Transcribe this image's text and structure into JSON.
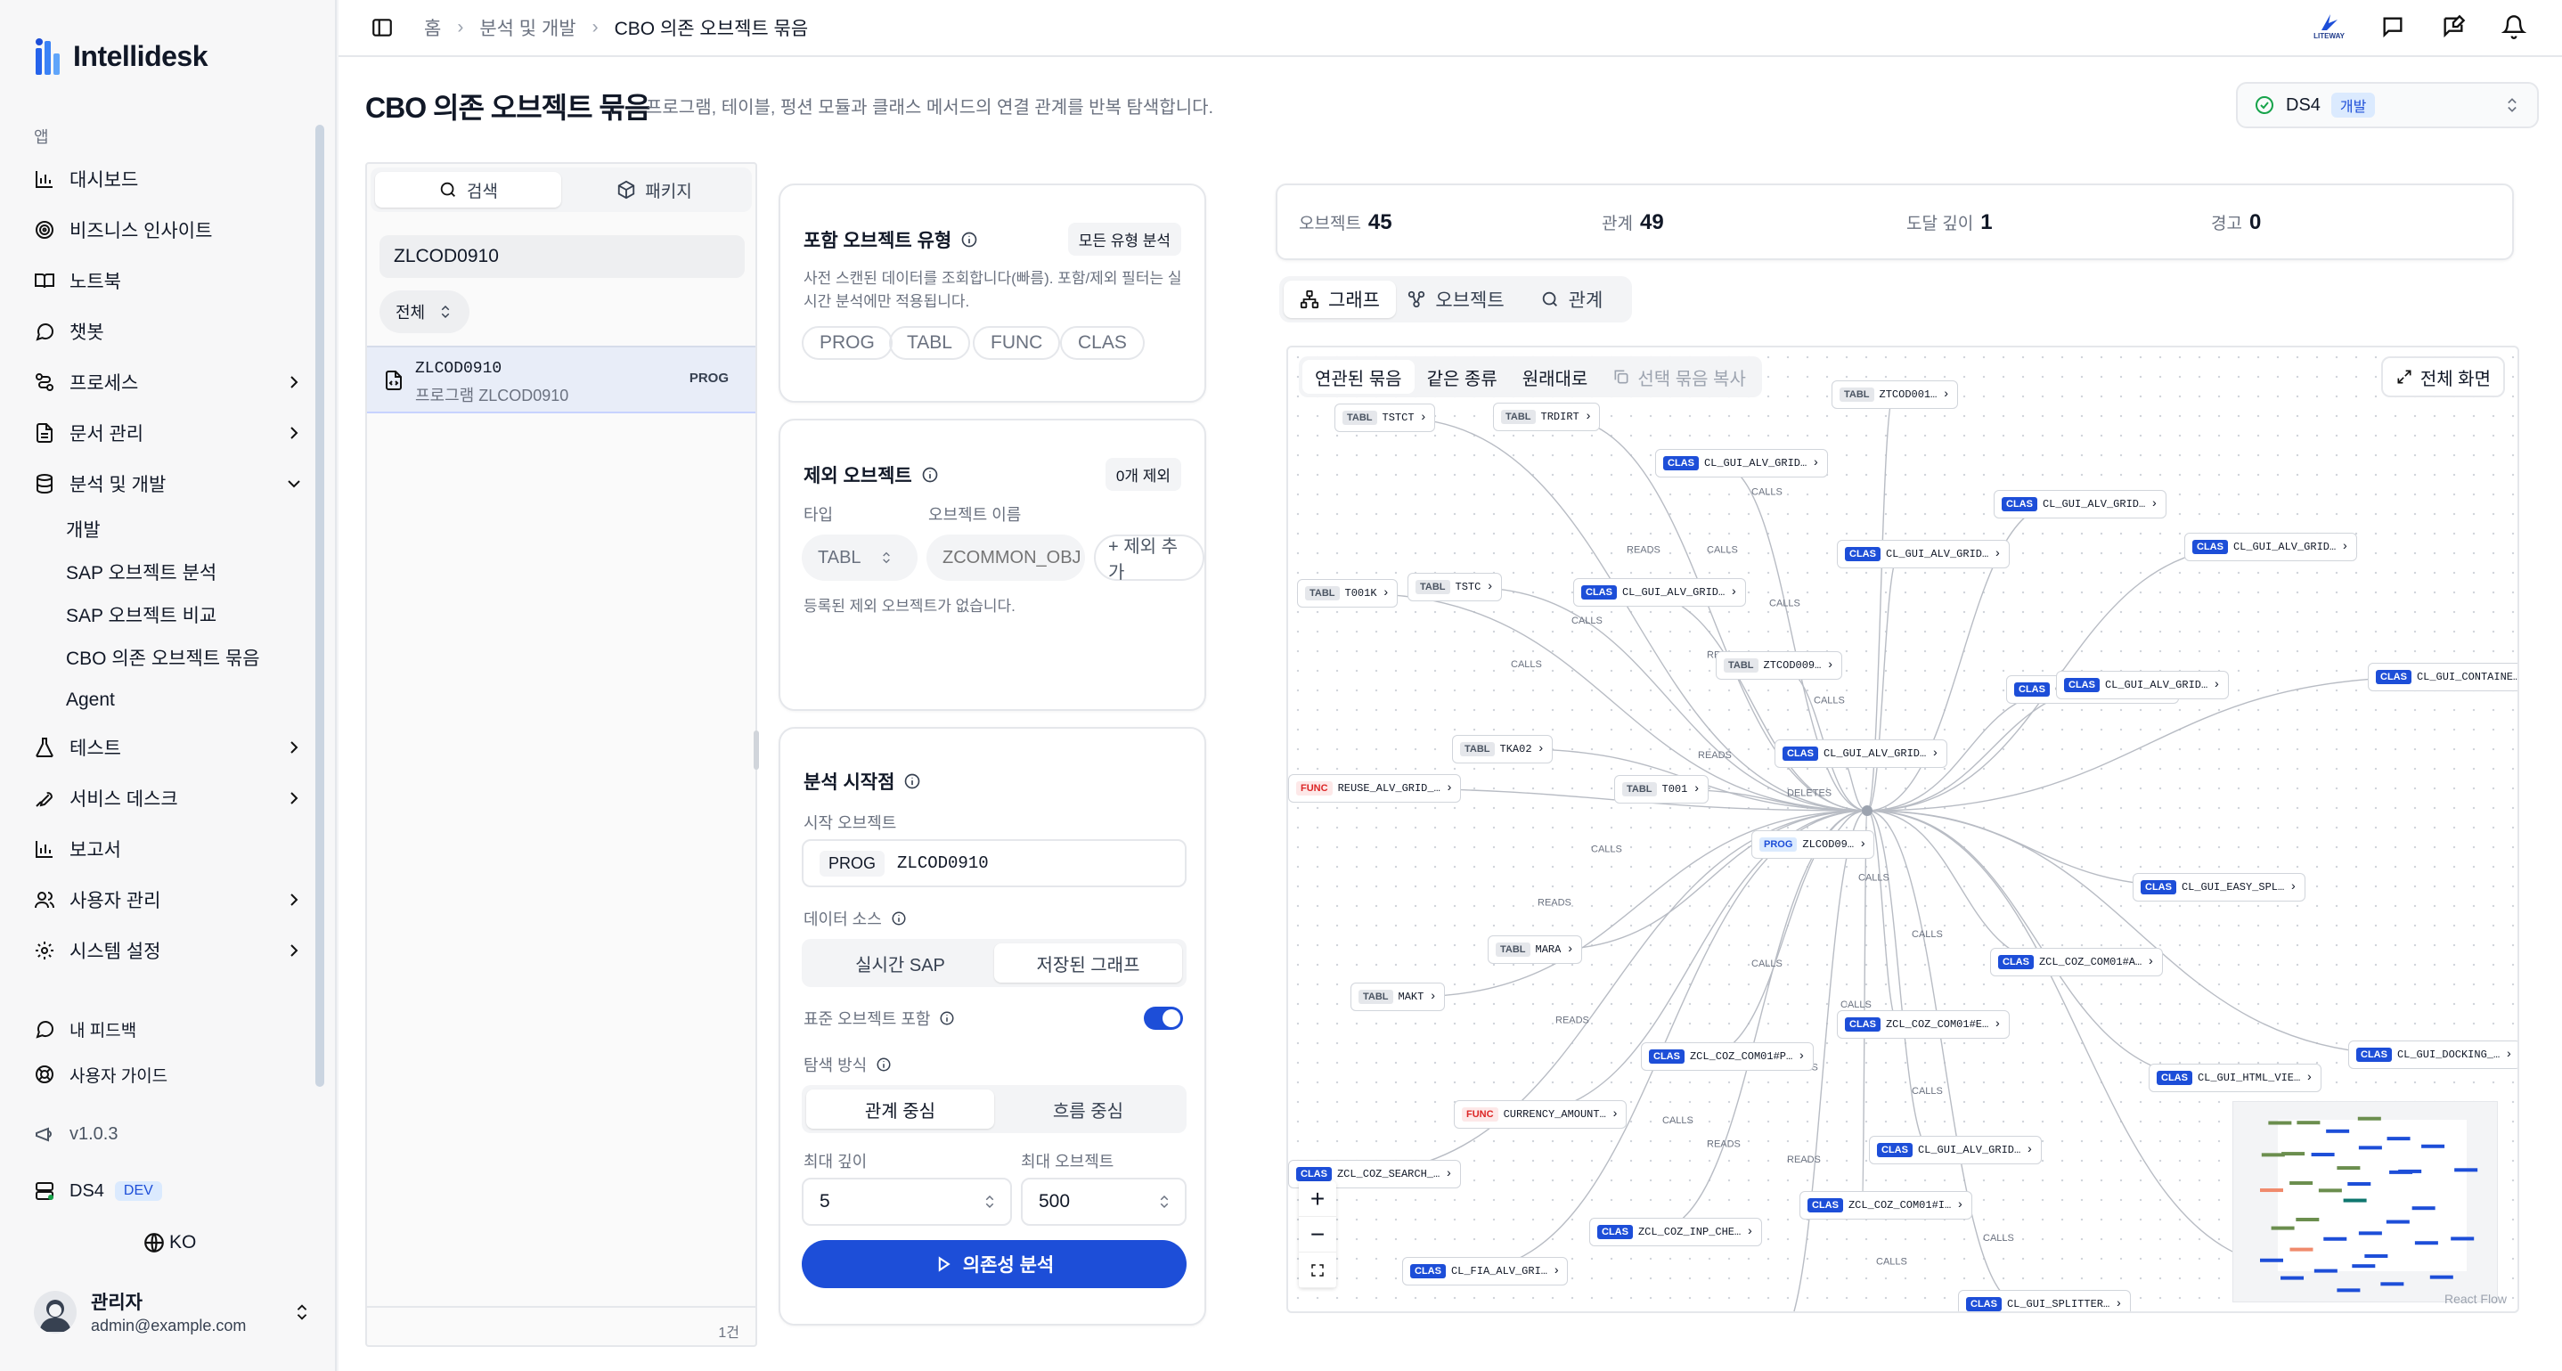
{
  "app": {
    "name": "Intellidesk"
  },
  "sidebar": {
    "section_label": "앱",
    "items": [
      {
        "label": "대시보드",
        "icon": "bar-chart-icon"
      },
      {
        "label": "비즈니스 인사이트",
        "icon": "target-icon"
      },
      {
        "label": "노트북",
        "icon": "book-icon"
      },
      {
        "label": "챗봇",
        "icon": "chat-icon"
      },
      {
        "label": "프로세스",
        "icon": "route-icon"
      },
      {
        "label": "문서 관리",
        "icon": "file-icon"
      },
      {
        "label": "분석 및 개발",
        "icon": "database-icon"
      },
      {
        "label": "테스트",
        "icon": "flask-icon"
      },
      {
        "label": "서비스 데스크",
        "icon": "wrench-icon"
      },
      {
        "label": "보고서",
        "icon": "bar-chart-icon"
      },
      {
        "label": "사용자 관리",
        "icon": "users-icon"
      },
      {
        "label": "시스템 설정",
        "icon": "gear-icon"
      }
    ],
    "sub_items": [
      "개발",
      "SAP 오브젝트 분석",
      "SAP 오브젝트 비교",
      "CBO 의존 오브젝트 묶음",
      "Agent"
    ],
    "feedback": "내 피드백",
    "guide": "사용자 가이드",
    "version": "v1.0.3",
    "system": "DS4",
    "system_badge": "DEV",
    "language": "KO",
    "user": {
      "name": "관리자",
      "email": "admin@example.com"
    }
  },
  "breadcrumb": [
    "홈",
    "분석 및 개발",
    "CBO 의존 오브젝트 묶음"
  ],
  "topbar": {
    "brand": "LITEWAY"
  },
  "page": {
    "title": "CBO 의존 오브젝트 묶음",
    "description": "프로그램, 테이블, 펑션 모듈과 클래스 메서드의 연결 관계를 반복 탐색합니다."
  },
  "env": {
    "name": "DS4",
    "badge": "개발"
  },
  "left_panel": {
    "tabs": [
      "검색",
      "패키지"
    ],
    "search_value": "ZLCOD0910",
    "filter": "전체",
    "results": [
      {
        "name": "ZLCOD0910",
        "desc": "프로그램 ZLCOD0910",
        "type": "PROG"
      }
    ],
    "count": "1건"
  },
  "include_card": {
    "title": "포함 오브젝트 유형",
    "pill": "모든 유형 분석",
    "desc": "사전 스캔된 데이터를 조회합니다(빠름). 포함/제외 필터는 실시간 분석에만 적용됩니다.",
    "types": [
      "PROG",
      "TABL",
      "FUNC",
      "CLAS"
    ]
  },
  "exclude_card": {
    "title": "제외 오브젝트",
    "pill": "0개 제외",
    "type_label": "타입",
    "name_label": "오브젝트 이름",
    "type_value": "TABL",
    "name_placeholder": "ZCOMMON_OBJ",
    "add_button": "+ 제외 추가",
    "empty": "등록된 제외 오브젝트가 없습니다."
  },
  "start_card": {
    "title": "분석 시작점",
    "start_label": "시작 오브젝트",
    "start_type": "PROG",
    "start_value": "ZLCOD0910",
    "source_label": "데이터 소스",
    "source_options": [
      "실시간 SAP",
      "저장된 그래프"
    ],
    "standard_label": "표준 오브젝트 포함",
    "mode_label": "탐색 방식",
    "mode_options": [
      "관계 중심",
      "흐름 중심"
    ],
    "depth_label": "최대 깊이",
    "depth_value": "5",
    "max_label": "최대 오브젝트",
    "max_value": "500",
    "run_button": "의존성 분석"
  },
  "stats": [
    {
      "label": "오브젝트",
      "value": "45"
    },
    {
      "label": "관계",
      "value": "49"
    },
    {
      "label": "도달 깊이",
      "value": "1"
    },
    {
      "label": "경고",
      "value": "0"
    }
  ],
  "view_tabs": [
    "그래프",
    "오브젝트",
    "관계"
  ],
  "graph_toolbar": [
    "연관된 묶음",
    "같은 종류",
    "원래대로",
    "선택 묶음 복사"
  ],
  "fullscreen": "전체 화면",
  "react_flow": "React Flow",
  "edge_labels": [
    "CALLS",
    "READS",
    "DELETES"
  ],
  "nodes": [
    {
      "type": "TABL",
      "name": "TSTCT"
    },
    {
      "type": "TABL",
      "name": "TRDIRT"
    },
    {
      "type": "CLAS",
      "name": "CL_GUI_ALV_GRID…"
    },
    {
      "type": "TABL",
      "name": "ZTCOD001…"
    },
    {
      "type": "CLAS",
      "name": "CL_GUI_ALV_GRID…"
    },
    {
      "type": "CLAS",
      "name": "CL_GUI_ALV_GRID…"
    },
    {
      "type": "CLAS",
      "name": "CL_GUI_ALV_GRID…"
    },
    {
      "type": "CLAS",
      "name": "CL_GUI_ALV_GRID…"
    },
    {
      "type": "TABL",
      "name": "T001K"
    },
    {
      "type": "TABL",
      "name": "TSTC"
    },
    {
      "type": "CLAS",
      "name": "CL_GUI_ALV_GRID…"
    },
    {
      "type": "TABL",
      "name": "ZTCOD009…"
    },
    {
      "type": "CLAS",
      "name": "CL_GUI_ALV_GRID…"
    },
    {
      "type": "CLAS",
      "name": "CL_GUI_CONTAINE…"
    },
    {
      "type": "TABL",
      "name": "TKA02"
    },
    {
      "type": "CLAS",
      "name": "CL_GUI_ALV_GRID…"
    },
    {
      "type": "FUNC",
      "name": "REUSE_ALV_GRID_…"
    },
    {
      "type": "TABL",
      "name": "T001"
    },
    {
      "type": "PROG",
      "name": "ZLCOD09…"
    },
    {
      "type": "CLAS",
      "name": "CL_GUI_EASY_SPL…"
    },
    {
      "type": "TABL",
      "name": "MARA"
    },
    {
      "type": "CLAS",
      "name": "ZCL_COZ_COM01#A…"
    },
    {
      "type": "TABL",
      "name": "MAKT"
    },
    {
      "type": "CLAS",
      "name": "ZCL_COZ_COM01#E…"
    },
    {
      "type": "CLAS",
      "name": "CL_GUI_DOCKING_…"
    },
    {
      "type": "CLAS",
      "name": "ZCL_COZ_COM01#P…"
    },
    {
      "type": "CLAS",
      "name": "CL_GUI_HTML_VIE…"
    },
    {
      "type": "FUNC",
      "name": "CURRENCY_AMOUNT…"
    },
    {
      "type": "CLAS",
      "name": "CL_GUI_ALV_GRID…"
    },
    {
      "type": "CLAS",
      "name": "ZCL_COZ_SEARCH_…"
    },
    {
      "type": "CLAS",
      "name": "ZCL_COZ_COM01#I…"
    },
    {
      "type": "CLAS",
      "name": "ZCL_COZ_INP_CHE…"
    },
    {
      "type": "CLAS",
      "name": "CL_GUI_SPLITTE…"
    },
    {
      "type": "CLAS",
      "name": "CL_FIA_ALV_GRI…"
    },
    {
      "type": "CLAS",
      "name": "CL_GUI_SPLITTER…"
    },
    {
      "type": "CLAS",
      "name": "ZCL_COZ_COM01#…"
    }
  ]
}
